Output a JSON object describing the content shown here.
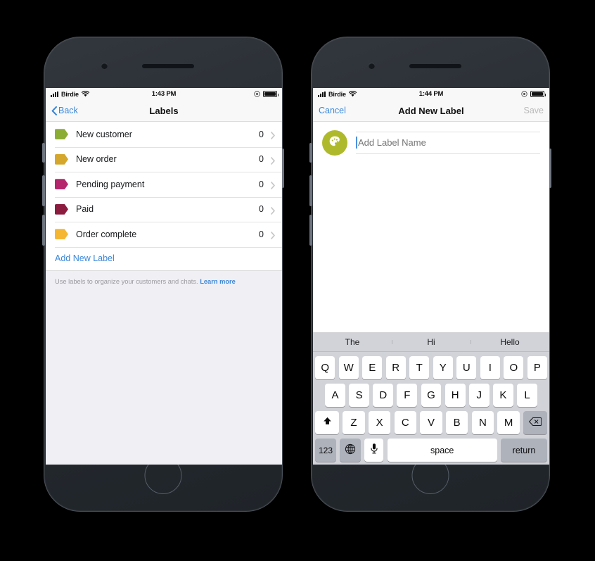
{
  "theme": {
    "accent_blue": "#3a87d9",
    "background": "#000000",
    "screen_bg": "#ffffff",
    "group_bg": "#efeff4",
    "keyboard_bg": "#d1d3d9"
  },
  "phone_left": {
    "status_bar": {
      "carrier": "Birdie",
      "time": "1:43 PM",
      "signal_icon": "signal-bars-icon",
      "wifi_icon": "wifi-icon",
      "location_icon": "location-services-icon",
      "battery_icon": "battery-full-icon"
    },
    "nav": {
      "back_label": "Back",
      "back_icon": "chevron-left-icon",
      "title": "Labels"
    },
    "labels": [
      {
        "name": "New customer",
        "count": "0",
        "color": "#8cad33",
        "chevron": "chevron-right-icon"
      },
      {
        "name": "New order",
        "count": "0",
        "color": "#d5a72c",
        "chevron": "chevron-right-icon"
      },
      {
        "name": "Pending payment",
        "count": "0",
        "color": "#b5256e",
        "chevron": "chevron-right-icon"
      },
      {
        "name": "Paid",
        "count": "0",
        "color": "#8c1d41",
        "chevron": "chevron-right-icon"
      },
      {
        "name": "Order complete",
        "count": "0",
        "color": "#f5b731",
        "chevron": "chevron-right-icon"
      }
    ],
    "add_new_label": "Add New Label",
    "footer": {
      "text": "Use labels to organize your customers and chats. ",
      "link": "Learn more"
    }
  },
  "phone_right": {
    "status_bar": {
      "carrier": "Birdie",
      "time": "1:44 PM",
      "signal_icon": "signal-bars-icon",
      "wifi_icon": "wifi-icon",
      "location_icon": "location-services-icon",
      "battery_icon": "battery-full-icon"
    },
    "nav": {
      "cancel_label": "Cancel",
      "title": "Add New Label",
      "save_label": "Save"
    },
    "form": {
      "color_swatch_icon": "palette-icon",
      "color_swatch_color": "#aeba2c",
      "name_value": "",
      "name_placeholder": "Add Label Name"
    },
    "keyboard": {
      "suggestions": [
        "The",
        "Hi",
        "Hello"
      ],
      "row1": [
        "Q",
        "W",
        "E",
        "R",
        "T",
        "Y",
        "U",
        "I",
        "O",
        "P"
      ],
      "row2": [
        "A",
        "S",
        "D",
        "F",
        "G",
        "H",
        "J",
        "K",
        "L"
      ],
      "row3": [
        "Z",
        "X",
        "C",
        "V",
        "B",
        "N",
        "M"
      ],
      "shift_icon": "shift-up-arrow-icon",
      "backspace_icon": "backspace-delete-icon",
      "numbers_label": "123",
      "globe_icon": "globe-language-icon",
      "mic_icon": "microphone-icon",
      "space_label": "space",
      "return_label": "return"
    }
  }
}
